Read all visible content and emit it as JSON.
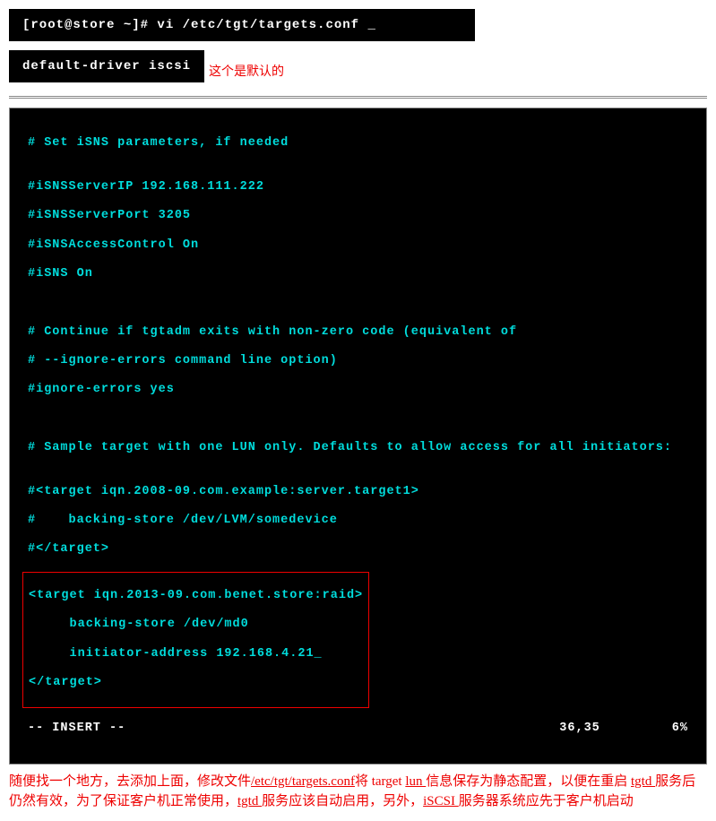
{
  "top_cmd": "[root@store ~]# vi /etc/tgt/targets.conf _",
  "config_line": "default-driver iscsi",
  "config_note": "这个是默认的",
  "editor": {
    "l1": "# Set iSNS parameters, if needed",
    "l2": "",
    "l3": "#iSNSServerIP 192.168.111.222",
    "l4": "#iSNSServerPort 3205",
    "l5": "#iSNSAccessControl On",
    "l6": "#iSNS On",
    "l7": "",
    "l8": "",
    "l9": "# Continue if tgtadm exits with non-zero code (equivalent of",
    "l10": "# --ignore-errors command line option)",
    "l11": "#ignore-errors yes",
    "l12": "",
    "l13": "",
    "l14": "# Sample target with one LUN only. Defaults to allow access for all initiators:",
    "l15": "",
    "l16": "#<target iqn.2008-09.com.example:server.target1>",
    "l17": "#    backing-store /dev/LVM/somedevice",
    "l18": "#</target>",
    "h1": "<target iqn.2013-09.com.benet.store:raid>",
    "h2": "     backing-store /dev/md0",
    "h3": "     initiator-address 192.168.4.21_",
    "h4": "</target>"
  },
  "status": {
    "mode": "-- INSERT --",
    "pos": "36,35",
    "pct": "6%"
  },
  "footer": {
    "p1a": "随便找一个地方，去添加上面，修改文件",
    "p1b": "/etc/tgt/targets.conf",
    "p1c": "将 target  ",
    "p1d": "lun ",
    "p1e": "信息保存为静态配置，以便在重启 ",
    "p2a": "tgtd ",
    "p2b": "服务后仍然有效，为了保证客户机正常使用，",
    "p2c": "tgtd ",
    "p2d": "服务应该自动启用，另外，",
    "p2e": "iSCSI ",
    "p2f": "服务器系统应先于客户机启动"
  }
}
